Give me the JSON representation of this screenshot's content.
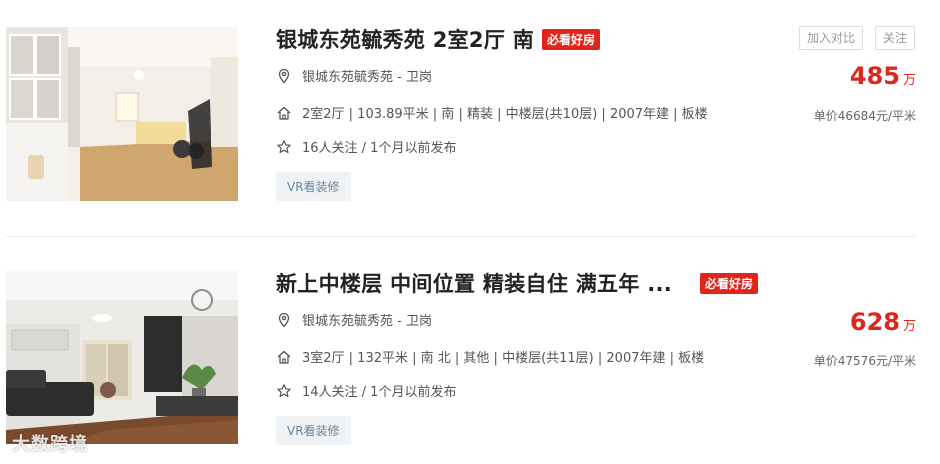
{
  "listings": [
    {
      "title": "银城东苑毓秀苑 2室2厅 南",
      "badge": "必看好房",
      "location": "银城东苑毓秀苑 - 卫岗",
      "house_info": "2室2厅 | 103.89平米 | 南 | 精装 | 中楼层(共10层) | 2007年建 | 板楼",
      "follow_info": "16人关注 / 1个月以前发布",
      "vr_label": "VR看装修",
      "compare_label": "加入对比",
      "follow_label": "关注",
      "price": "485",
      "price_unit": "万",
      "unit_price": "单价46684元/平米"
    },
    {
      "title": "新上中楼层 中间位置 精装自住 满五年 ...",
      "badge": "必看好房",
      "location": "银城东苑毓秀苑 - 卫岗",
      "house_info": "3室2厅 | 132平米 | 南 北 | 其他 | 中楼层(共11层) | 2007年建 | 板楼",
      "follow_info": "14人关注 / 1个月以前发布",
      "vr_label": "VR看装修",
      "price": "628",
      "price_unit": "万",
      "unit_price": "单价47576元/平米"
    }
  ],
  "watermark": "大数跨境",
  "colors": {
    "accent": "#e1251b",
    "vr_bg": "#f0f3f6",
    "vr_text": "#6b8397"
  }
}
